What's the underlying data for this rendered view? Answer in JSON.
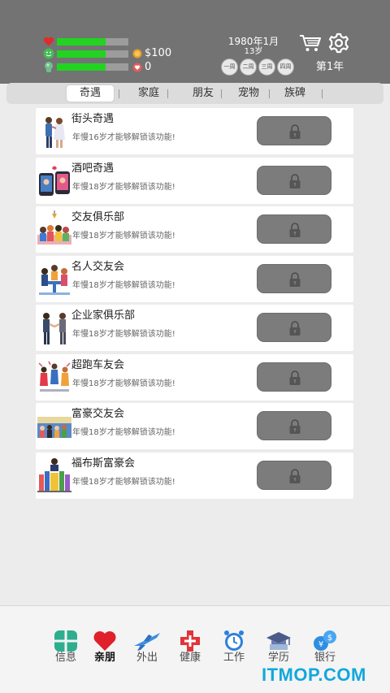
{
  "status": {
    "health_level": 0.68,
    "happiness_level": 0.68,
    "smarts_level": 0.68,
    "money": "$100",
    "charm": "0"
  },
  "header": {
    "date": "1980年1月",
    "age": "13岁",
    "week_buttons": [
      "一周",
      "二周",
      "三周",
      "四周"
    ],
    "year_label": "第1年"
  },
  "tabs": [
    "奇遇",
    "家庭",
    "朋友",
    "宠物",
    "族碑"
  ],
  "active_tab": "奇遇",
  "cards": [
    {
      "title": "街头奇遇",
      "subtitle": "年慢16岁才能够解锁该功能!"
    },
    {
      "title": "酒吧奇遇",
      "subtitle": "年慢18岁才能够解锁该功能!"
    },
    {
      "title": "交友俱乐部",
      "subtitle": "年慢18岁才能够解锁该功能!"
    },
    {
      "title": "名人交友会",
      "subtitle": "年慢18岁才能够解锁该功能!"
    },
    {
      "title": "企业家俱乐部",
      "subtitle": "年慢18岁才能够解锁该功能!"
    },
    {
      "title": "超跑车友会",
      "subtitle": "年慢18岁才能够解锁该功能!"
    },
    {
      "title": "富豪交友会",
      "subtitle": "年慢18岁才能够解锁该功能!"
    },
    {
      "title": "福布斯富豪会",
      "subtitle": "年慢18岁才能够解锁该功能!"
    }
  ],
  "bottom_nav": [
    {
      "label": "信息",
      "icon": "info-grid-icon"
    },
    {
      "label": "亲朋",
      "icon": "heart-icon"
    },
    {
      "label": "外出",
      "icon": "airplane-icon"
    },
    {
      "label": "健康",
      "icon": "medical-cross-icon"
    },
    {
      "label": "工作",
      "icon": "alarm-clock-icon"
    },
    {
      "label": "学历",
      "icon": "graduation-cap-icon"
    },
    {
      "label": "银行",
      "icon": "currency-exchange-icon"
    }
  ],
  "active_nav": "亲朋",
  "watermark": "ITMOP.COM",
  "colors": {
    "header_bg": "#737373",
    "stat_bar_fill": "#22d322",
    "lock_button": "#7c7c7c",
    "watermark": "#12a7dd"
  }
}
